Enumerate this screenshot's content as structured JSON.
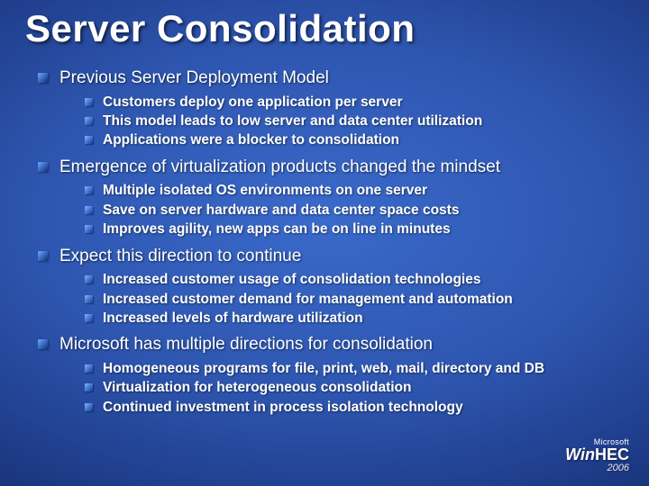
{
  "title": "Server Consolidation",
  "sections": [
    {
      "heading": "Previous Server Deployment Model",
      "items": [
        "Customers deploy one application per server",
        "This model leads to low server and data center utilization",
        "Applications were a blocker to consolidation"
      ]
    },
    {
      "heading": "Emergence of virtualization products changed the mindset",
      "items": [
        "Multiple isolated OS environments on one server",
        "Save on server hardware and data center space costs",
        "Improves agility, new apps can be on line in minutes"
      ]
    },
    {
      "heading": "Expect this direction to continue",
      "items": [
        "Increased customer usage of consolidation technologies",
        "Increased customer demand for management and automation",
        "Increased levels of hardware utilization"
      ]
    },
    {
      "heading": "Microsoft has multiple directions for consolidation",
      "items": [
        "Homogeneous programs for file, print, web, mail, directory and DB",
        "Virtualization for heterogeneous consolidation",
        "Continued investment in process isolation technology"
      ]
    }
  ],
  "logo": {
    "company": "Microsoft",
    "brand_prefix": "Win",
    "brand_suffix": "HEC",
    "year": "2006"
  }
}
